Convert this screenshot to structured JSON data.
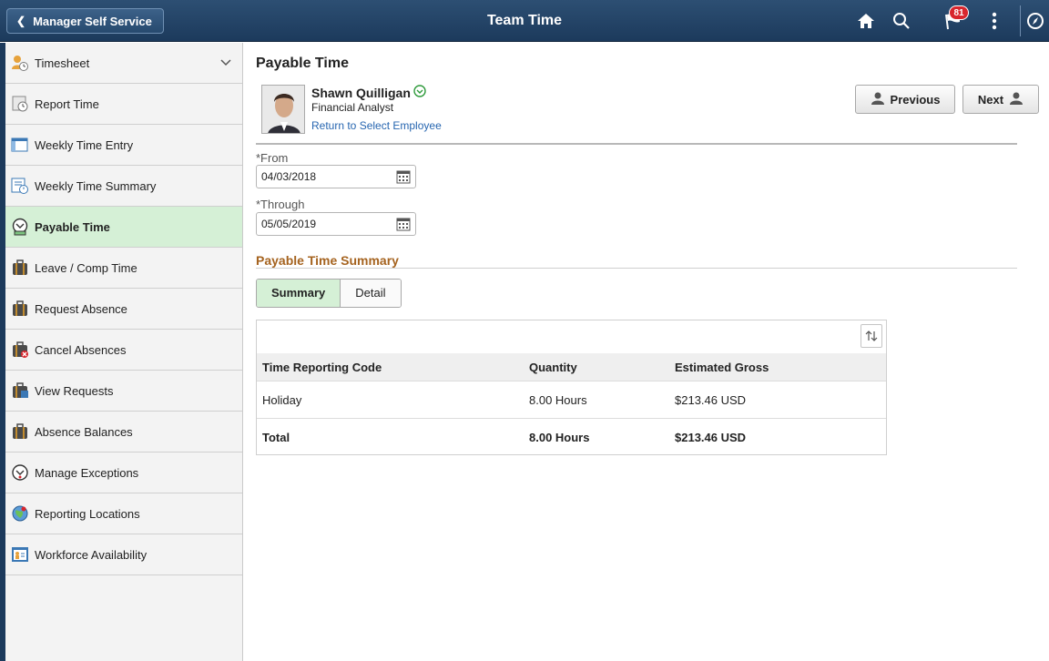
{
  "header": {
    "back_label": "Manager Self Service",
    "title": "Team Time",
    "notification_count": "81",
    "icons": [
      "home-icon",
      "search-icon",
      "notification-flag-icon",
      "actions-menu-icon",
      "navbar-compass-icon"
    ]
  },
  "sidebar": {
    "items": [
      {
        "label": "Timesheet",
        "icon": "timesheet-icon",
        "active": false
      },
      {
        "label": "Report Time",
        "icon": "report-time-icon",
        "active": false
      },
      {
        "label": "Weekly Time Entry",
        "icon": "weekly-entry-icon",
        "active": false
      },
      {
        "label": "Weekly Time Summary",
        "icon": "weekly-summary-icon",
        "active": false
      },
      {
        "label": "Payable Time",
        "icon": "payable-time-icon",
        "active": true
      },
      {
        "label": "Leave / Comp Time",
        "icon": "leave-icon",
        "active": false
      },
      {
        "label": "Request Absence",
        "icon": "request-absence-icon",
        "active": false
      },
      {
        "label": "Cancel Absences",
        "icon": "cancel-absence-icon",
        "active": false
      },
      {
        "label": "View Requests",
        "icon": "view-requests-icon",
        "active": false
      },
      {
        "label": "Absence Balances",
        "icon": "absence-balances-icon",
        "active": false
      },
      {
        "label": "Manage Exceptions",
        "icon": "manage-exceptions-icon",
        "active": false
      },
      {
        "label": "Reporting Locations",
        "icon": "reporting-locations-icon",
        "active": false
      },
      {
        "label": "Workforce Availability",
        "icon": "workforce-availability-icon",
        "active": false
      }
    ]
  },
  "main": {
    "title": "Payable Time",
    "employee": {
      "name": "Shawn Quilligan",
      "job_title": "Financial Analyst",
      "return_link": "Return to Select Employee"
    },
    "previous_label": "Previous",
    "next_label": "Next",
    "from_label": "*From",
    "from_value": "04/03/2018",
    "through_label": "*Through",
    "through_value": "05/05/2019",
    "section_title": "Payable Time Summary",
    "tabs": [
      {
        "label": "Summary",
        "active": true
      },
      {
        "label": "Detail",
        "active": false
      }
    ],
    "table": {
      "columns": [
        "Time Reporting Code",
        "Quantity",
        "Estimated Gross"
      ],
      "rows": [
        [
          "Holiday",
          "8.00 Hours",
          "$213.46 USD"
        ]
      ],
      "total": [
        "Total",
        "8.00 Hours",
        "$213.46 USD"
      ]
    }
  },
  "colors": {
    "header_bg": "#1c3a5c",
    "active_green": "#d5f0d6",
    "section_title": "#a5631f",
    "link_blue": "#2766b0",
    "badge_red": "#d8262d"
  }
}
